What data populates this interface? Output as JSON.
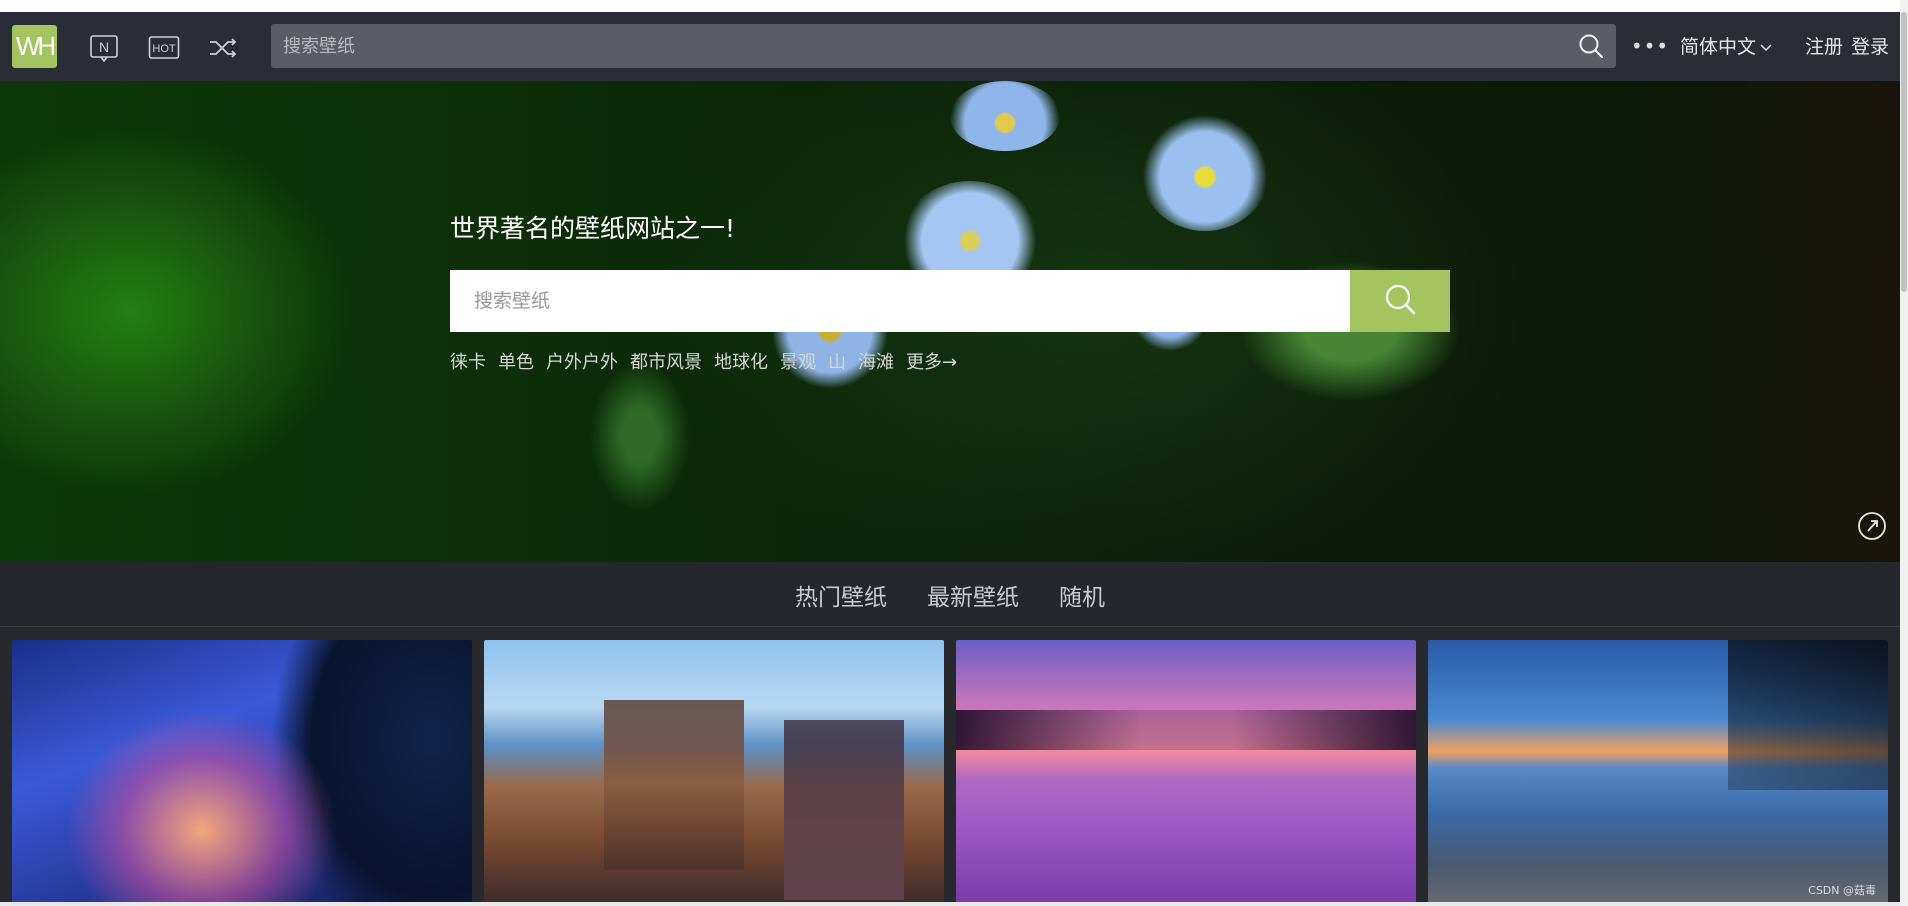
{
  "brand": {
    "logo_text": "WH",
    "accent": "#a3c45e"
  },
  "navbar": {
    "icons": [
      "new-icon",
      "hot-icon",
      "shuffle-icon"
    ],
    "search_placeholder": "搜索壁纸",
    "more_label": "•••",
    "language": "简体中文",
    "register": "注册",
    "login": "登录"
  },
  "hero": {
    "title": "世界著名的壁纸网站之一!",
    "search_placeholder": "搜索壁纸",
    "tags": [
      "徕卡",
      "单色",
      "户外户外",
      "都市风景",
      "地球化",
      "景观",
      "山",
      "海滩",
      "更多→"
    ]
  },
  "tabs": [
    "热门壁纸",
    "最新壁纸",
    "随机"
  ],
  "gallery": {
    "thumbnails": [
      "space-planet-nebula",
      "anime-harbor-town",
      "purple-sunset-lake",
      "blue-twilight-beach"
    ]
  },
  "watermark": "CSDN @菇毒"
}
